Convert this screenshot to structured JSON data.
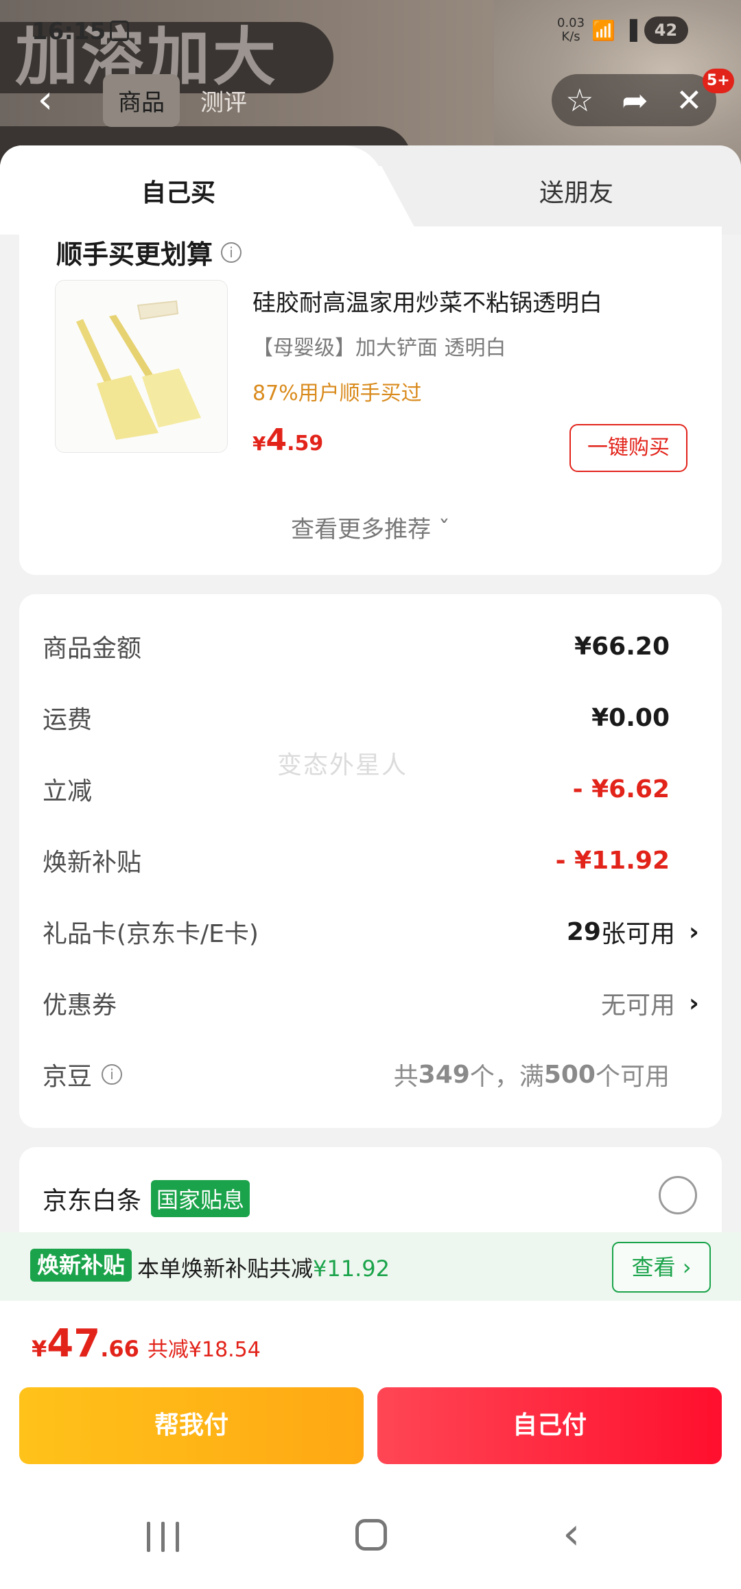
{
  "status_bar": {
    "time": "16:15",
    "net_speed_value": "0.03",
    "net_speed_unit": "K/s",
    "battery": "42"
  },
  "product_page": {
    "banner_text": "加溶加大",
    "tabs": [
      "商品",
      "测评"
    ],
    "active_tab": "商品",
    "badge": "5+"
  },
  "sheet": {
    "tabs": {
      "mine": "自己买",
      "friend": "送朋友"
    }
  },
  "recommend": {
    "title": "顺手买更划算",
    "product_name": "硅胶耐高温家用炒菜不粘锅透明白",
    "spec": "【母婴级】加大铲面 透明白",
    "stat": "87%用户顺手买过",
    "price_currency": "¥",
    "price_int": "4",
    "price_dec": ".59",
    "buy_button": "一键购买",
    "more": "查看更多推荐"
  },
  "summary": {
    "rows": [
      {
        "label": "商品金额",
        "value": "¥66.20"
      },
      {
        "label": "运费",
        "value": "¥0.00"
      },
      {
        "label": "立减",
        "value": "- ¥6.62"
      },
      {
        "label": "焕新补贴",
        "value": "- ¥11.92"
      },
      {
        "label": "礼品卡(京东卡/E卡)",
        "value_num": "29",
        "value_txt": "张可用"
      },
      {
        "label": "优惠券",
        "value": "无可用"
      },
      {
        "label": "京豆",
        "value_parts": [
          "共",
          "349",
          "个，满",
          "500",
          "个可用"
        ]
      }
    ],
    "watermark": "变态外星人"
  },
  "payment": {
    "label": "京东白条",
    "tag": "国家贴息"
  },
  "subsidy": {
    "tag": "焕新补贴",
    "text": "本单焕新补贴共减",
    "amount": "¥11.92",
    "button": "查看"
  },
  "total": {
    "currency": "¥",
    "int": "47",
    "dec": ".66",
    "saved": "共减¥18.54"
  },
  "actions": {
    "help_pay": "帮我付",
    "self_pay": "自己付"
  },
  "colors": {
    "accent_red": "#e2231a",
    "green": "#1aa34a",
    "orange": "#d98a1c"
  }
}
